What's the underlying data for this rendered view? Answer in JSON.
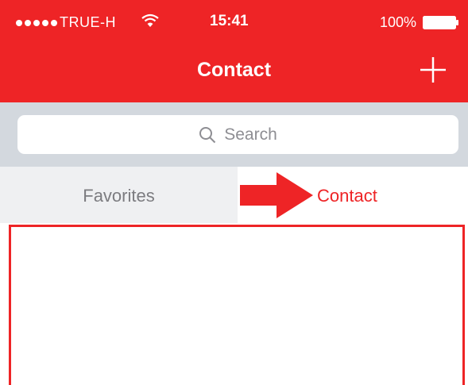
{
  "status_bar": {
    "carrier": "TRUE-H",
    "time": "15:41",
    "battery": "100%"
  },
  "nav": {
    "title": "Contact",
    "add_icon": "plus-icon"
  },
  "search": {
    "placeholder": "Search",
    "icon": "search-icon"
  },
  "tabs": {
    "favorites": "Favorites",
    "contact": "Contact",
    "selected": "Contact"
  },
  "colors": {
    "accent": "#ee2426",
    "search_bg": "#d3d8de",
    "inactive_tab_bg": "#eff0f2"
  }
}
